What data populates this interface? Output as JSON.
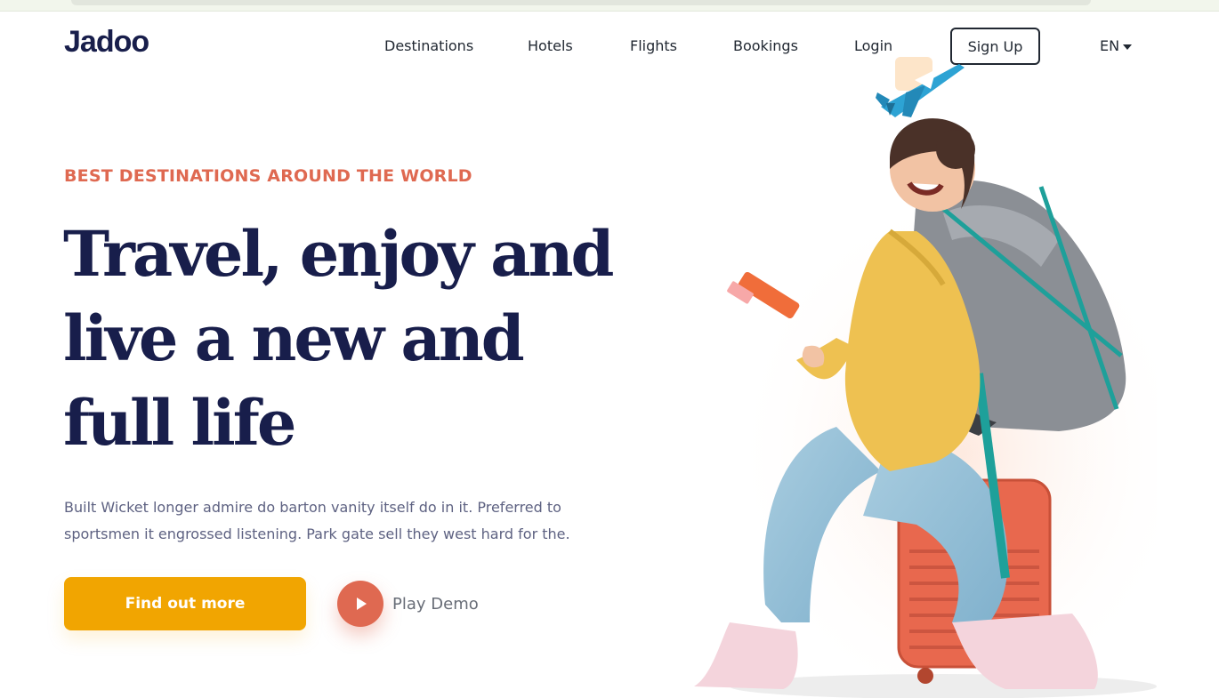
{
  "brand": {
    "logo_text": "Jadoo"
  },
  "nav": {
    "items": [
      {
        "label": "Destinations"
      },
      {
        "label": "Hotels"
      },
      {
        "label": "Flights"
      },
      {
        "label": "Bookings"
      },
      {
        "label": "Login"
      }
    ],
    "signup_label": "Sign Up",
    "language": "EN"
  },
  "hero": {
    "eyebrow": "BEST DESTINATIONS AROUND THE WORLD",
    "headline_lines": [
      "Travel, enjoy and",
      "live a new and",
      "full life"
    ],
    "description_lines": [
      "Built Wicket longer admire do barton vanity itself do in it. Preferred to",
      "sportsmen it engrossed listening. Park gate sell they west hard for the."
    ],
    "cta_label": "Find out more",
    "play_label": "Play Demo"
  },
  "colors": {
    "brand_navy": "#181e4b",
    "accent_orange": "#df6951",
    "accent_yellow": "#f1a501",
    "text_gray": "#5e6282"
  },
  "icons": {
    "plane": "airplane-icon",
    "play": "play-icon",
    "caret": "caret-down-icon"
  }
}
